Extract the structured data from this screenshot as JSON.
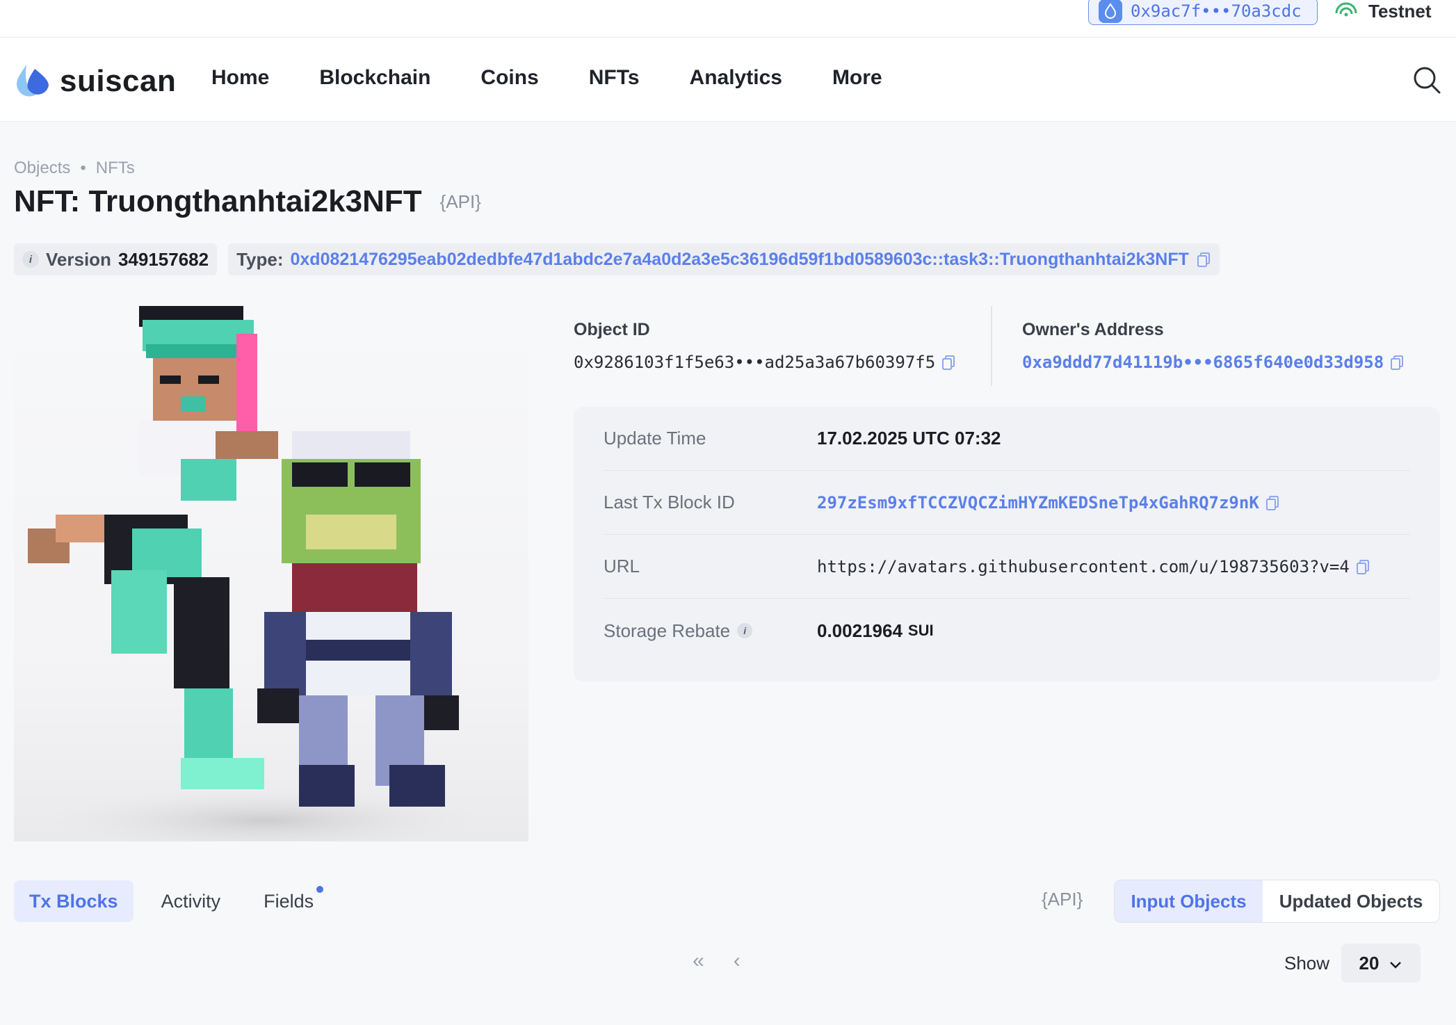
{
  "wallet": {
    "address": "0x9ac7f•••70a3cdc",
    "icon": "droplet-icon"
  },
  "network": {
    "label": "Testnet",
    "icon": "signal-icon",
    "color": "#3cb371"
  },
  "brand": {
    "name": "suiscan",
    "accent": "#5b7fe9"
  },
  "nav": {
    "items": [
      "Home",
      "Blockchain",
      "Coins",
      "NFTs",
      "Analytics",
      "More"
    ]
  },
  "breadcrumb": {
    "items": [
      "Objects",
      "NFTs"
    ],
    "separator": "•"
  },
  "page": {
    "title": "NFT: Truongthanhtai2k3NFT",
    "api_label": "{API}"
  },
  "chips": {
    "version_label": "Version",
    "version_value": "349157682",
    "type_label": "Type:",
    "type_value": "0xd0821476295eab02dedbfe47d1abdc2e7a4a0d2a3e5c36196d59f1bd0589603c::task3::Truongthanhtai2k3NFT"
  },
  "object": {
    "label": "Object ID",
    "value": "0x9286103f1f5e63•••ad25a3a67b60397f5"
  },
  "owner": {
    "label": "Owner's Address",
    "value": "0xa9ddd77d41119b•••6865f640e0d33d958"
  },
  "details": {
    "update_time_label": "Update Time",
    "update_time_value": "17.02.2025 UTC 07:32",
    "last_tx_label": "Last Tx Block ID",
    "last_tx_value": "297zEsm9xfTCCZVQCZimHYZmKEDSneTp4xGahRQ7z9nK",
    "url_label": "URL",
    "url_value": "https://avatars.githubusercontent.com/u/198735603?v=4",
    "storage_label": "Storage Rebate",
    "storage_value": "0.0021964",
    "storage_unit": "SUI"
  },
  "tabs": {
    "items": [
      "Tx Blocks",
      "Activity",
      "Fields"
    ],
    "active": "Tx Blocks"
  },
  "segment": {
    "api_label": "{API}",
    "input_label": "Input Objects",
    "updated_label": "Updated Objects"
  },
  "pager": {
    "first": "«",
    "prev": "‹",
    "show_label": "Show",
    "show_value": "20"
  }
}
